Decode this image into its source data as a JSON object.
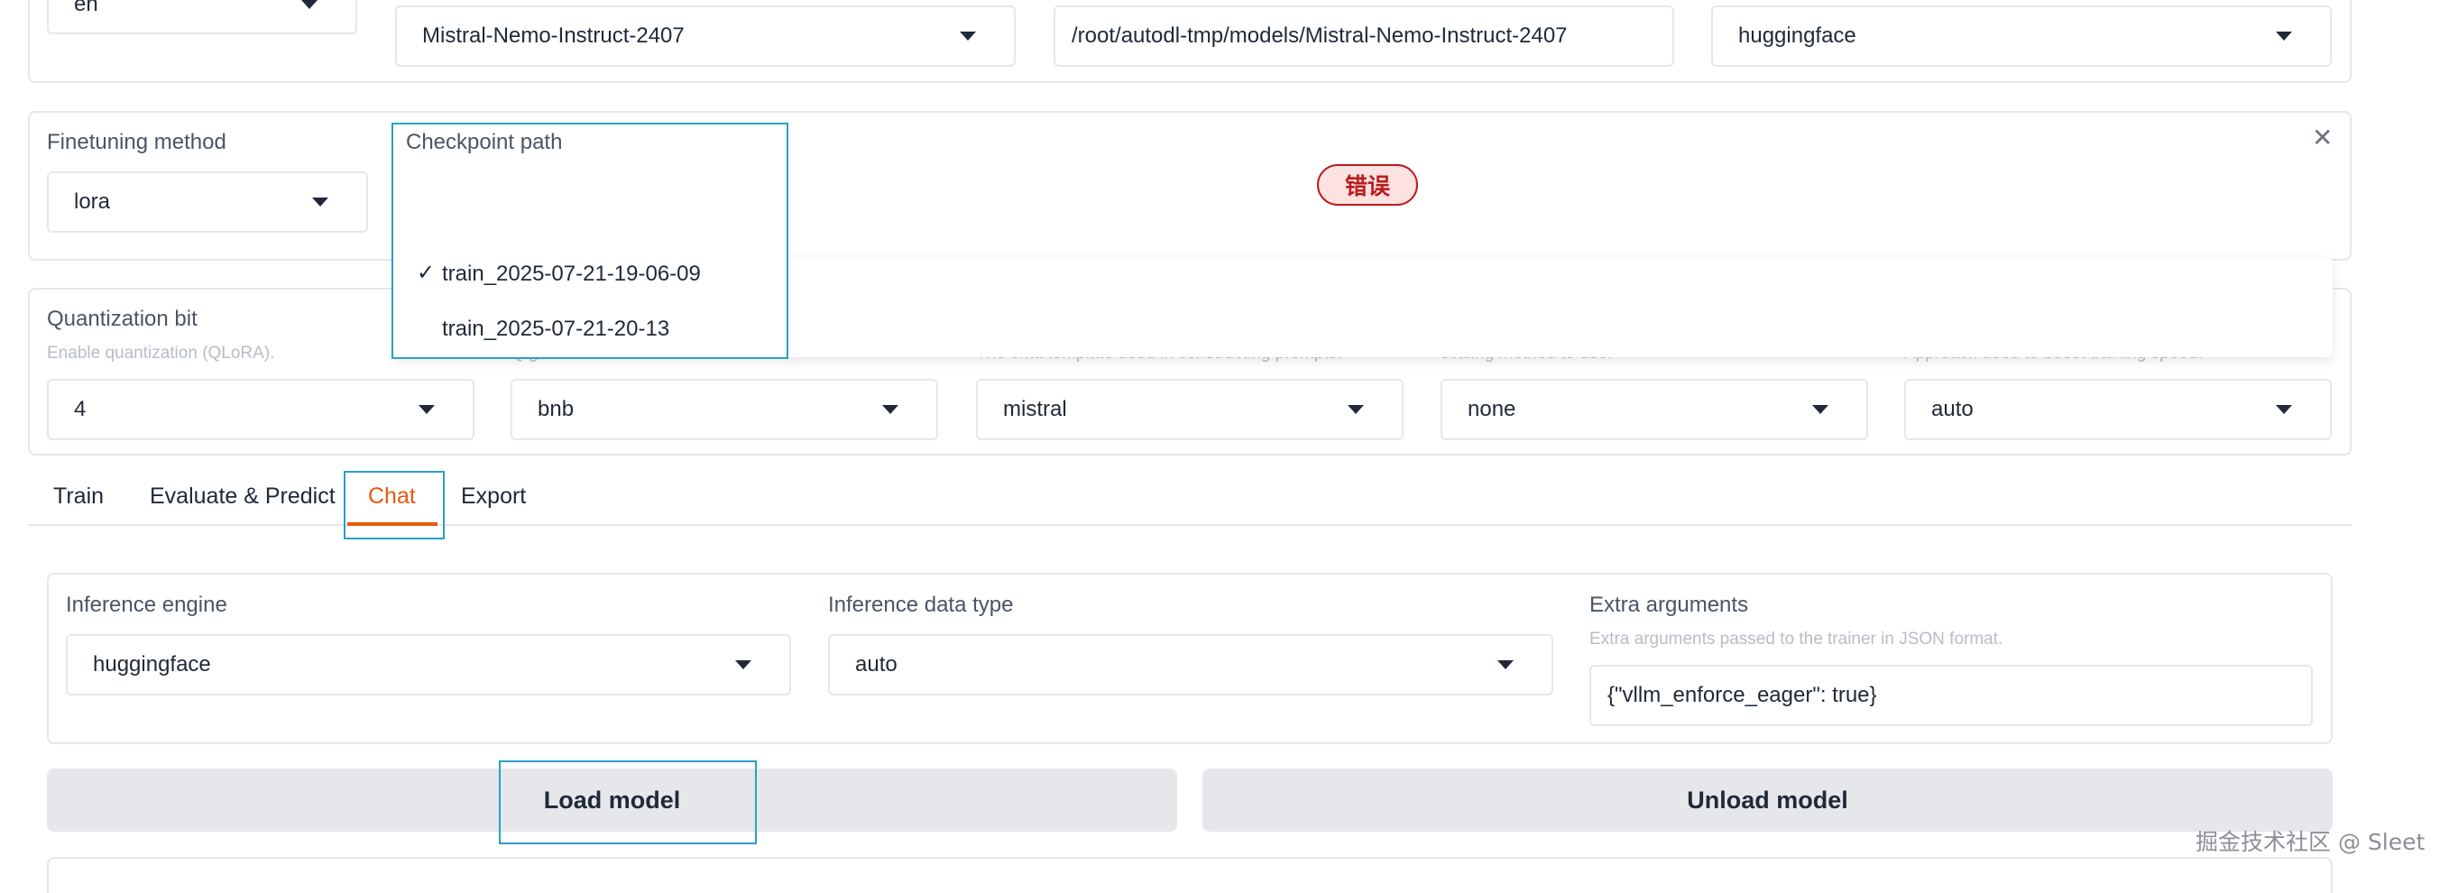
{
  "model_row": {
    "language_value": "en",
    "model_name_value": "Mistral-Nemo-Instruct-2407",
    "model_path_value": "/root/autodl-tmp/models/Mistral-Nemo-Instruct-2407",
    "hub_value": "huggingface"
  },
  "finetune_row": {
    "finetuning_method_label": "Finetuning method",
    "finetuning_method_value": "lora",
    "checkpoint_path_label": "Checkpoint path",
    "checkpoint_options": [
      {
        "label": "train_2025-07-21-19-06-09",
        "selected": true,
        "check": "✓"
      },
      {
        "label": "train_2025-07-21-20-13",
        "selected": false,
        "check": ""
      }
    ],
    "error_badge": "错误",
    "close_glyph": "✕"
  },
  "quant_row": {
    "quantization_bit_label": "Quantization bit",
    "quantization_bit_hint": "Enable quantization (QLoRA).",
    "quantization_bit_value": "4",
    "quantization_method_hint": "Q             g             ed",
    "quantization_method_value": "bnb",
    "template_hint": "The chat template used in constructing prompts.",
    "template_value": "mistral",
    "rope_hint": "     scaling method to use.",
    "rope_value": "none",
    "booster_hint": "Approach used to boost training speed.",
    "booster_value": "auto"
  },
  "tabs": [
    {
      "label": "Train",
      "active": false
    },
    {
      "label": "Evaluate & Predict",
      "active": false
    },
    {
      "label": "Chat",
      "active": true
    },
    {
      "label": "Export",
      "active": false
    }
  ],
  "chat_panel": {
    "inference_engine_label": "Inference engine",
    "inference_engine_value": "huggingface",
    "inference_dtype_label": "Inference data type",
    "inference_dtype_value": "auto",
    "extra_args_label": "Extra arguments",
    "extra_args_hint": "Extra arguments passed to the trainer in JSON format.",
    "extra_args_value": "{\"vllm_enforce_eager\": true}"
  },
  "buttons": {
    "load_model": "Load model",
    "unload_model": "Unload model"
  },
  "watermark": "掘金技术社区 @ Sleet",
  "colors": {
    "accent_orange": "#ea580c",
    "focus_blue": "#29a0c9",
    "error_red": "#b91c1c",
    "error_bg": "#fee2e2"
  }
}
